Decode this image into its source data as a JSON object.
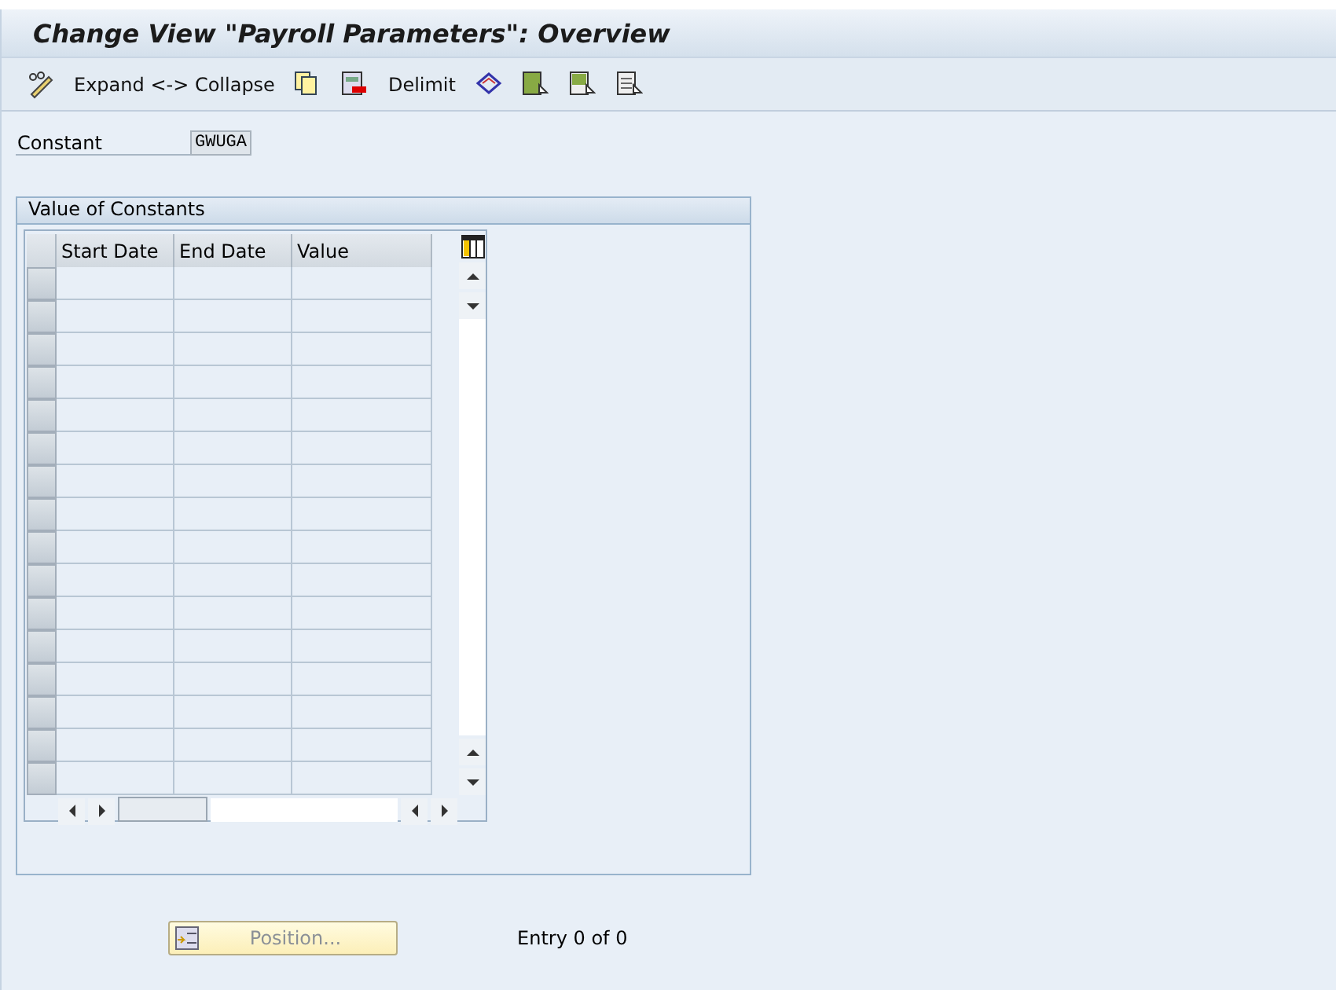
{
  "window": {
    "title": "Change View \"Payroll Parameters\": Overview"
  },
  "toolbar": {
    "items": [
      {
        "kind": "pencil"
      },
      {
        "kind": "text",
        "label": "Expand <-> Collapse"
      },
      {
        "kind": "copy"
      },
      {
        "kind": "delete"
      },
      {
        "kind": "text",
        "label": "Delimit"
      },
      {
        "kind": "diamond"
      },
      {
        "kind": "selectall"
      },
      {
        "kind": "selectblock"
      },
      {
        "kind": "deselect"
      }
    ]
  },
  "constant": {
    "label": "Constant",
    "value": "GWUGA"
  },
  "group": {
    "title": "Value of Constants",
    "table": {
      "columns": [
        "Start Date",
        "End Date",
        "Value"
      ]
    }
  },
  "footer": {
    "position_button": "Position...",
    "entry": "Entry 0 of 0"
  }
}
